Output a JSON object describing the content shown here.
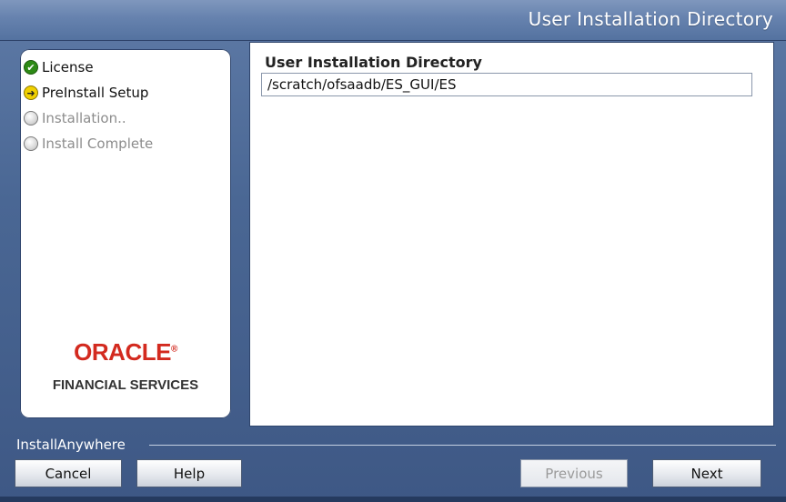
{
  "window": {
    "title": "User Installation Directory"
  },
  "steps": [
    {
      "label": "License",
      "state": "done",
      "icon": "check-icon"
    },
    {
      "label": "PreInstall Setup",
      "state": "current",
      "icon": "arrow-right-icon"
    },
    {
      "label": "Installation..",
      "state": "pending",
      "icon": "circle-icon"
    },
    {
      "label": "Install Complete",
      "state": "pending",
      "icon": "circle-icon"
    }
  ],
  "logo": {
    "brand": "ORACLE",
    "mark": "®",
    "subtitle": "FINANCIAL SERVICES"
  },
  "main": {
    "field_label": "User Installation Directory",
    "field_value": "/scratch/ofsaadb/ES_GUI/ES"
  },
  "footer": {
    "installer_label": "InstallAnywhere",
    "buttons": {
      "cancel": "Cancel",
      "help": "Help",
      "previous": "Previous",
      "next": "Next"
    }
  },
  "colors": {
    "done": "#2d8a16",
    "current": "#f0d000",
    "oracle_red": "#d32a1f",
    "frame": "#4a6794"
  }
}
